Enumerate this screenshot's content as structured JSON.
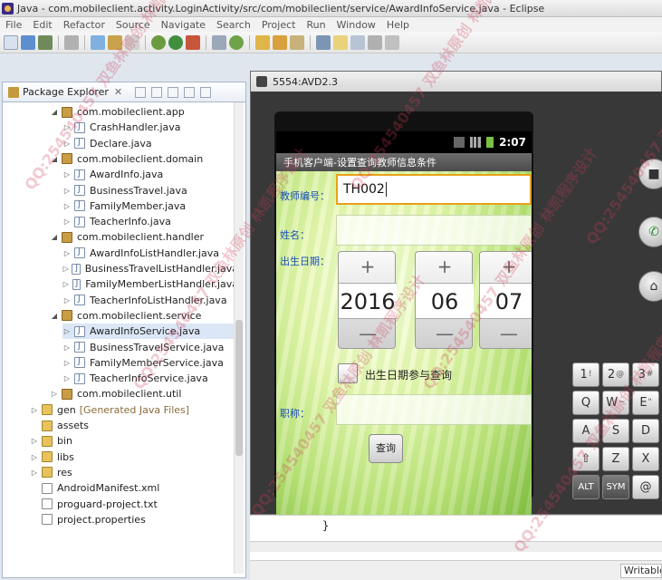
{
  "window": {
    "title": "Java - com.mobileclient.activity.LoginActivity/src/com/mobileclient/service/AwardInfoService.java - Eclipse"
  },
  "menu": [
    "File",
    "Edit",
    "Refactor",
    "Source",
    "Navigate",
    "Search",
    "Project",
    "Run",
    "Window",
    "Help"
  ],
  "explorer": {
    "tab_label": "Package Explorer",
    "tab_close": "✕",
    "tree": [
      {
        "label": "com.mobileclient.app",
        "kind": "pkg",
        "indent": 1,
        "expanded": true
      },
      {
        "label": "CrashHandler.java",
        "kind": "java",
        "indent": 2
      },
      {
        "label": "Declare.java",
        "kind": "java",
        "indent": 2
      },
      {
        "label": "com.mobileclient.domain",
        "kind": "pkg",
        "indent": 1,
        "expanded": true
      },
      {
        "label": "AwardInfo.java",
        "kind": "java",
        "indent": 2
      },
      {
        "label": "BusinessTravel.java",
        "kind": "java",
        "indent": 2
      },
      {
        "label": "FamilyMember.java",
        "kind": "java",
        "indent": 2
      },
      {
        "label": "TeacherInfo.java",
        "kind": "java",
        "indent": 2
      },
      {
        "label": "com.mobileclient.handler",
        "kind": "pkg",
        "indent": 1,
        "expanded": true
      },
      {
        "label": "AwardInfoListHandler.java",
        "kind": "java",
        "indent": 2
      },
      {
        "label": "BusinessTravelListHandler.java",
        "kind": "java",
        "indent": 2
      },
      {
        "label": "FamilyMemberListHandler.java",
        "kind": "java",
        "indent": 2
      },
      {
        "label": "TeacherInfoListHandler.java",
        "kind": "java",
        "indent": 2
      },
      {
        "label": "com.mobileclient.service",
        "kind": "pkg",
        "indent": 1,
        "expanded": true
      },
      {
        "label": "AwardInfoService.java",
        "kind": "java",
        "indent": 2,
        "selected": true
      },
      {
        "label": "BusinessTravelService.java",
        "kind": "java",
        "indent": 2
      },
      {
        "label": "FamilyMemberService.java",
        "kind": "java",
        "indent": 2
      },
      {
        "label": "TeacherInfoService.java",
        "kind": "java",
        "indent": 2
      },
      {
        "label": "com.mobileclient.util",
        "kind": "pkg",
        "indent": 1,
        "expanded": false
      },
      {
        "label": "gen",
        "suffix": "[Generated Java Files]",
        "kind": "folder",
        "indent": 0,
        "expanded": false
      },
      {
        "label": "assets",
        "kind": "folder",
        "indent": 0
      },
      {
        "label": "bin",
        "kind": "folder",
        "indent": 0,
        "expanded": false
      },
      {
        "label": "libs",
        "kind": "folder",
        "indent": 0,
        "expanded": false
      },
      {
        "label": "res",
        "kind": "folder",
        "indent": 0,
        "expanded": false
      },
      {
        "label": "AndroidManifest.xml",
        "kind": "file",
        "indent": 0
      },
      {
        "label": "proguard-project.txt",
        "kind": "file",
        "indent": 0
      },
      {
        "label": "project.properties",
        "kind": "file",
        "indent": 0
      }
    ]
  },
  "emulator": {
    "title": "5554:AVD2.3",
    "status_time": "2:07",
    "app_title": "手机客户端-设置查询教师信息条件",
    "teacher_no_label": "教师编号：",
    "teacher_no_value": "TH002",
    "name_label": "姓名：",
    "birth_label": "出生日期：",
    "date_year": "2016",
    "date_month": "06",
    "date_day": "07",
    "plus_glyph": "+",
    "minus_glyph": "—",
    "birth_check_label": "出生日期参与查询",
    "title_label": "职称：",
    "query_button": "查询"
  },
  "keyboard": {
    "rows": [
      [
        {
          "main": "1",
          "sub": "!"
        },
        {
          "main": "2",
          "sub": "@"
        },
        {
          "main": "3",
          "sub": "#"
        }
      ],
      [
        {
          "main": "Q",
          "sub": ""
        },
        {
          "main": "W",
          "sub": "~"
        },
        {
          "main": "E",
          "sub": "\""
        }
      ],
      [
        {
          "main": "A",
          "sub": ""
        },
        {
          "main": "S",
          "sub": ""
        },
        {
          "main": "D",
          "sub": ""
        }
      ],
      [
        {
          "main": "⇧",
          "sub": ""
        },
        {
          "main": "Z",
          "sub": ""
        },
        {
          "main": "X",
          "sub": ""
        }
      ],
      [
        {
          "main": "ALT",
          "sub": ""
        },
        {
          "main": "SYM",
          "sub": ""
        },
        {
          "main": "@",
          "sub": ""
        }
      ]
    ]
  },
  "editor": {
    "visible_code": "}",
    "status_writable": "Writable"
  },
  "watermark_text": "QQ:254540457 双鱼林原创 林凯程序设计"
}
